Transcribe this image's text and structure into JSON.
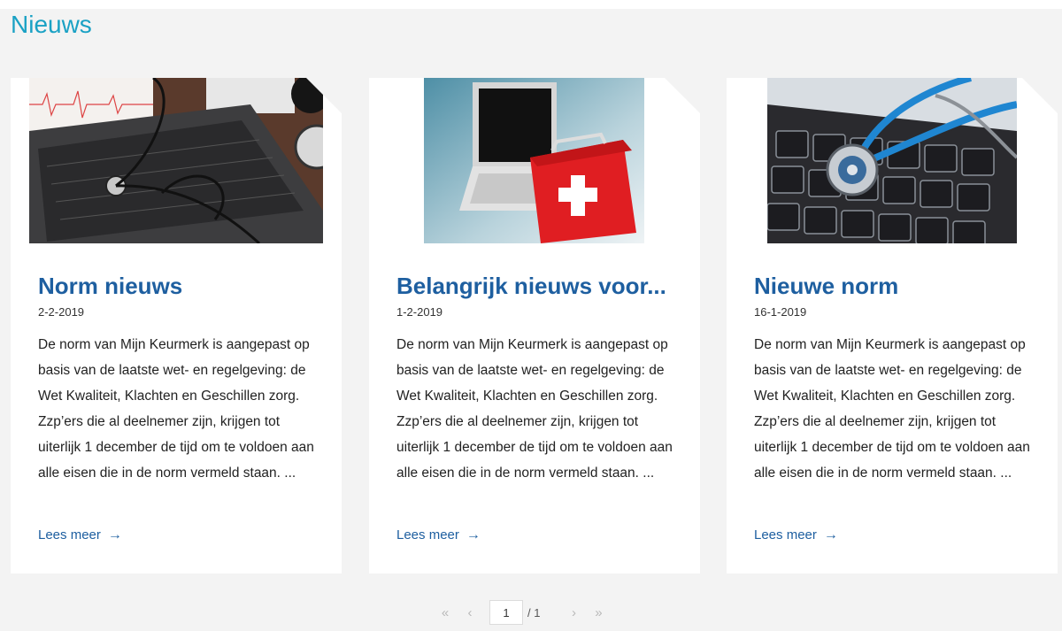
{
  "section": {
    "title": "Nieuws"
  },
  "articles": [
    {
      "title": "Norm nieuws",
      "date": "2-2-2019",
      "excerpt": "De norm van Mijn Keurmerk is aangepast op basis van de laatste wet- en regelgeving: de Wet Kwaliteit, Klachten en Geschillen zorg. Zzp’ers die al deelnemer zijn, krijgen tot uiterlijk 1 december de tijd om te voldoen aan alle eisen die in de norm vermeld staan. ...",
      "read_more": "Lees meer",
      "image": "laptop-stethoscope-ecg-photo"
    },
    {
      "title": "Belangrijk nieuws voor...",
      "date": "1-2-2019",
      "excerpt": "De norm van Mijn Keurmerk is aangepast op basis van de laatste wet- en regelgeving: de Wet Kwaliteit, Klachten en Geschillen zorg. Zzp’ers die al deelnemer zijn, krijgen tot uiterlijk 1 december de tijd om te voldoen aan alle eisen die in de norm vermeld staan. ...",
      "read_more": "Lees meer",
      "image": "laptop-first-aid-kit-photo"
    },
    {
      "title": "Nieuwe norm",
      "date": "16-1-2019",
      "excerpt": "De norm van Mijn Keurmerk is aangepast op basis van de laatste wet- en regelgeving: de Wet Kwaliteit, Klachten en Geschillen zorg. Zzp’ers die al deelnemer zijn, krijgen tot uiterlijk 1 december de tijd om te voldoen aan alle eisen die in de norm vermeld staan. ...",
      "read_more": "Lees meer",
      "image": "keyboard-stethoscope-photo"
    }
  ],
  "pagination": {
    "first_icon": "«",
    "prev_icon": "‹",
    "current_page": "1",
    "total_label": "/ 1",
    "next_icon": "›",
    "last_icon": "»"
  },
  "colors": {
    "title": "#1aa1c4",
    "link": "#1e5fa0",
    "background": "#f3f3f3"
  }
}
